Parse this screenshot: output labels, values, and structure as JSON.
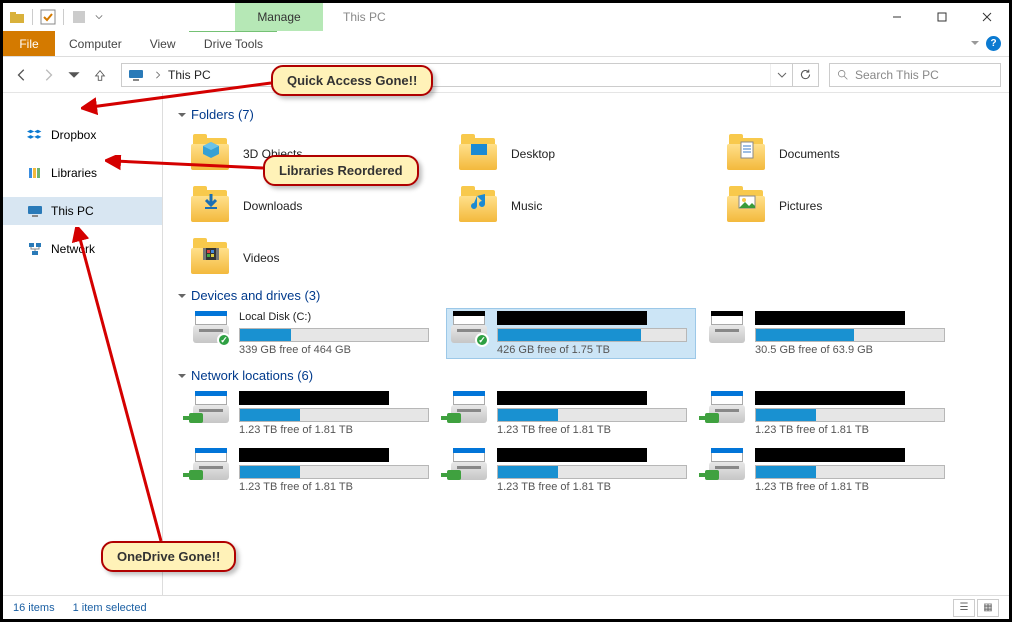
{
  "window": {
    "title": "This PC",
    "manage_tab": "Manage"
  },
  "ribbon": {
    "file": "File",
    "computer": "Computer",
    "view": "View",
    "drive_tools": "Drive Tools"
  },
  "address": {
    "location": "This PC"
  },
  "search": {
    "placeholder": "Search This PC"
  },
  "sidebar": {
    "items": [
      {
        "label": "Dropbox",
        "icon": "dropbox-icon"
      },
      {
        "label": "Libraries",
        "icon": "libraries-icon"
      },
      {
        "label": "This PC",
        "icon": "pc-icon",
        "selected": true
      },
      {
        "label": "Network",
        "icon": "network-icon"
      }
    ]
  },
  "sections": {
    "folders": {
      "title": "Folders (7)",
      "items": [
        {
          "label": "3D Objects"
        },
        {
          "label": "Desktop"
        },
        {
          "label": "Documents"
        },
        {
          "label": "Downloads"
        },
        {
          "label": "Music"
        },
        {
          "label": "Pictures"
        },
        {
          "label": "Videos"
        }
      ]
    },
    "drives": {
      "title": "Devices and drives (3)",
      "items": [
        {
          "name": "Local Disk (C:)",
          "free": "339 GB free of 464 GB",
          "fill_pct": 27,
          "selected": false,
          "check": true
        },
        {
          "name_redacted": true,
          "free": "426 GB free of 1.75 TB",
          "fill_pct": 76,
          "selected": true,
          "check": true
        },
        {
          "name_redacted": true,
          "free": "30.5 GB free of 63.9 GB",
          "fill_pct": 52,
          "selected": false
        }
      ]
    },
    "network": {
      "title": "Network locations (6)",
      "items": [
        {
          "name_redacted": true,
          "free": "1.23 TB free of 1.81 TB",
          "fill_pct": 32
        },
        {
          "name_redacted": true,
          "free": "1.23 TB free of 1.81 TB",
          "fill_pct": 32
        },
        {
          "name_redacted": true,
          "free": "1.23 TB free of 1.81 TB",
          "fill_pct": 32
        },
        {
          "name_redacted": true,
          "free": "1.23 TB free of 1.81 TB",
          "fill_pct": 32
        },
        {
          "name_redacted": true,
          "free": "1.23 TB free of 1.81 TB",
          "fill_pct": 32
        },
        {
          "name_redacted": true,
          "free": "1.23 TB free of 1.81 TB",
          "fill_pct": 32
        }
      ]
    }
  },
  "status": {
    "count": "16 items",
    "selected": "1 item selected"
  },
  "callouts": {
    "quick_access": "Quick Access Gone!!",
    "libraries": "Libraries Reordered",
    "onedrive": "OneDrive Gone!!"
  }
}
